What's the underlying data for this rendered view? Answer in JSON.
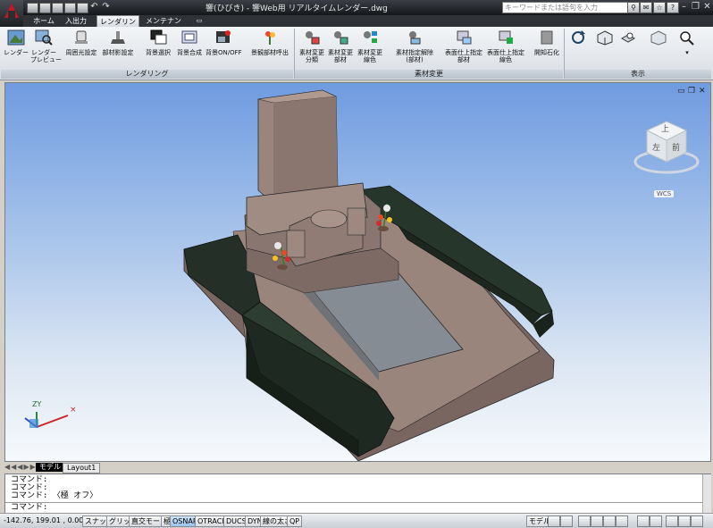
{
  "title_bar": {
    "title": "響(ひびき) - 響Web用 リアルタイムレンダー.dwg",
    "search_placeholder": "キーワードまたは語句を入力",
    "help_glyph": "?"
  },
  "tabs": [
    {
      "label": "ホーム"
    },
    {
      "label": "入出力"
    },
    {
      "label": "レンダリング"
    },
    {
      "label": "メンテナンス"
    }
  ],
  "ribbon": {
    "panels": [
      {
        "label": "レンダリング"
      },
      {
        "label": "素材変更"
      },
      {
        "label": "表示"
      }
    ],
    "rendering_buttons": [
      {
        "label": "レンダー",
        "icon": "teapot-render-icon"
      },
      {
        "label": "レンダー\nプレビュー",
        "icon": "render-preview-icon"
      },
      {
        "label": "周囲光設定",
        "icon": "ambient-light-icon"
      },
      {
        "label": "部材影設定",
        "icon": "shadow-icon"
      },
      {
        "label": "背景選択",
        "icon": "background-select-icon"
      },
      {
        "label": "背景合成",
        "icon": "background-compose-icon"
      },
      {
        "label": "背景ON/OFF",
        "icon": "background-toggle-icon"
      },
      {
        "label": "景観部材呼出",
        "icon": "landscape-part-icon"
      }
    ],
    "material_buttons": [
      {
        "label": "素材変更\n分類",
        "icon": "material-category-icon"
      },
      {
        "label": "素材変更\n部材",
        "icon": "material-part-icon"
      },
      {
        "label": "素材変更\n線色",
        "icon": "material-linecolor-icon"
      },
      {
        "label": "素材指定解除\n(部材)",
        "icon": "material-clear-icon"
      },
      {
        "label": "表面仕上指定\n部材",
        "icon": "surface-part-icon"
      },
      {
        "label": "表面仕上指定\n線色",
        "icon": "surface-linecolor-icon"
      },
      {
        "label": "開知石化",
        "icon": "stone-icon"
      }
    ]
  },
  "viewcube": {
    "top": "上",
    "left": "左",
    "front": "前",
    "wcs": "WCS"
  },
  "layout_tabs": [
    {
      "label": "モデル",
      "active": true
    },
    {
      "label": "Layout1",
      "active": false
    }
  ],
  "command": {
    "lines": [
      "コマンド:",
      "コマンド:",
      "コマンド: 〈極 オフ〉"
    ],
    "prompt": "コマンド:"
  },
  "status": {
    "coords": "-142.76, 199.01 , 0.00",
    "buttons": [
      {
        "label": "スナップ",
        "on": false
      },
      {
        "label": "グリッド",
        "on": false
      },
      {
        "label": "直交モード",
        "on": false
      },
      {
        "label": "極",
        "on": false
      },
      {
        "label": "OSNAP",
        "on": true
      },
      {
        "label": "OTRACK",
        "on": false
      },
      {
        "label": "DUCS",
        "on": false
      },
      {
        "label": "DYN",
        "on": false
      },
      {
        "label": "線の太さ",
        "on": false
      },
      {
        "label": "QP",
        "on": false
      }
    ],
    "model_label": "モデル"
  },
  "colors": {
    "granite": "#8f7b72",
    "dark_stone": "#2a3a2e",
    "gray_gravel": "#8a8f97",
    "sky_top": "#6f9be0"
  }
}
